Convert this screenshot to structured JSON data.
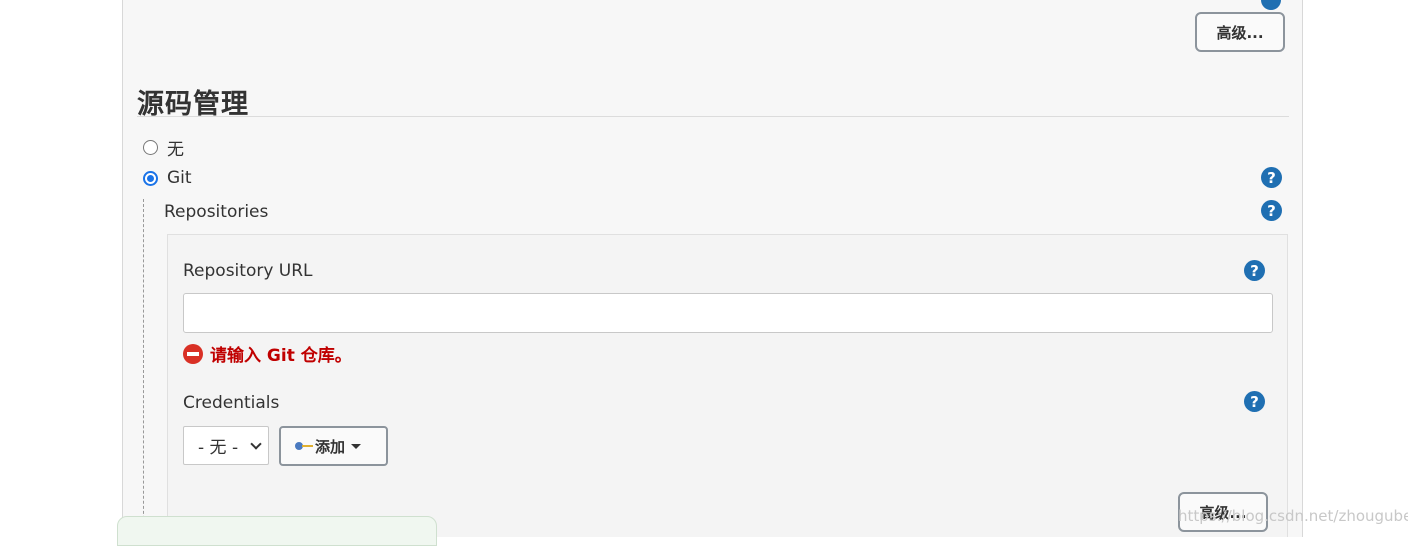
{
  "top": {
    "partial_text": "",
    "advanced_label": "高级..."
  },
  "scm": {
    "title": "源码管理",
    "options": [
      {
        "label": "无",
        "checked": false
      },
      {
        "label": "Git",
        "checked": true
      }
    ]
  },
  "repositories": {
    "label": "Repositories",
    "url_label": "Repository URL",
    "url_value": "",
    "error_text": "请输入 Git 仓库。",
    "credentials_label": "Credentials",
    "credentials_selected": "- 无 -",
    "add_label": "添加",
    "advanced_label": "高级..."
  },
  "help_glyph": "?",
  "watermark": "https://blog.csdn.net/zhougubei",
  "colors": {
    "help_blue": "#1f6fb2",
    "error_red": "#c00000",
    "radio_blue": "#1a73e8"
  }
}
